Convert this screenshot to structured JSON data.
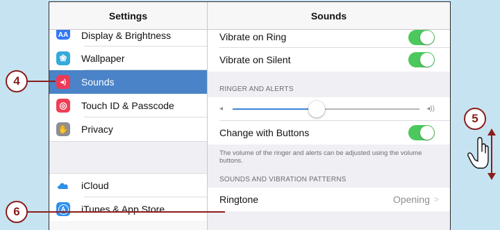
{
  "colors": {
    "accent_blue": "#4a83c7",
    "toggle_green": "#4cc85c",
    "callout_red": "#8b1c1c",
    "background": "#c6e3f1"
  },
  "master": {
    "title": "Settings",
    "items": [
      {
        "label": "Display & Brightness",
        "icon": "display-brightness-icon",
        "icon_text": "AA",
        "icon_color": "#3478f6"
      },
      {
        "label": "Wallpaper",
        "icon": "wallpaper-icon",
        "icon_text": "❀",
        "icon_color": "#35aadc"
      },
      {
        "label": "Sounds",
        "icon": "sounds-icon",
        "icon_text": "◂)",
        "icon_color": "#ee3a57",
        "selected": true
      },
      {
        "label": "Touch ID & Passcode",
        "icon": "fingerprint-icon",
        "icon_text": "◎",
        "icon_color": "#ef3f56"
      },
      {
        "label": "Privacy",
        "icon": "hand-icon",
        "icon_text": "✋",
        "icon_color": "#8e8e93"
      }
    ],
    "items2": [
      {
        "label": "iCloud",
        "icon": "cloud-icon"
      },
      {
        "label": "iTunes & App Store",
        "icon": "app-store-icon",
        "icon_text": "A",
        "icon_color": "#2e8ef0"
      }
    ]
  },
  "detail": {
    "title": "Sounds",
    "vibrate_on_ring": {
      "label": "Vibrate on Ring",
      "on": true
    },
    "vibrate_on_silent": {
      "label": "Vibrate on Silent",
      "on": true
    },
    "ringer_header": "RINGER AND ALERTS",
    "ringer_volume": 0.45,
    "vol_low_icon": "◂",
    "vol_high_icon": "◂))",
    "change_with_buttons": {
      "label": "Change with Buttons",
      "on": true
    },
    "footnote": "The volume of the ringer and alerts can be adjusted using the volume buttons.",
    "patterns_header": "SOUNDS AND VIBRATION PATTERNS",
    "ringtone": {
      "label": "Ringtone",
      "value": "Opening",
      "chevron": ">"
    }
  },
  "callouts": {
    "four": "4",
    "five": "5",
    "six": "6"
  }
}
